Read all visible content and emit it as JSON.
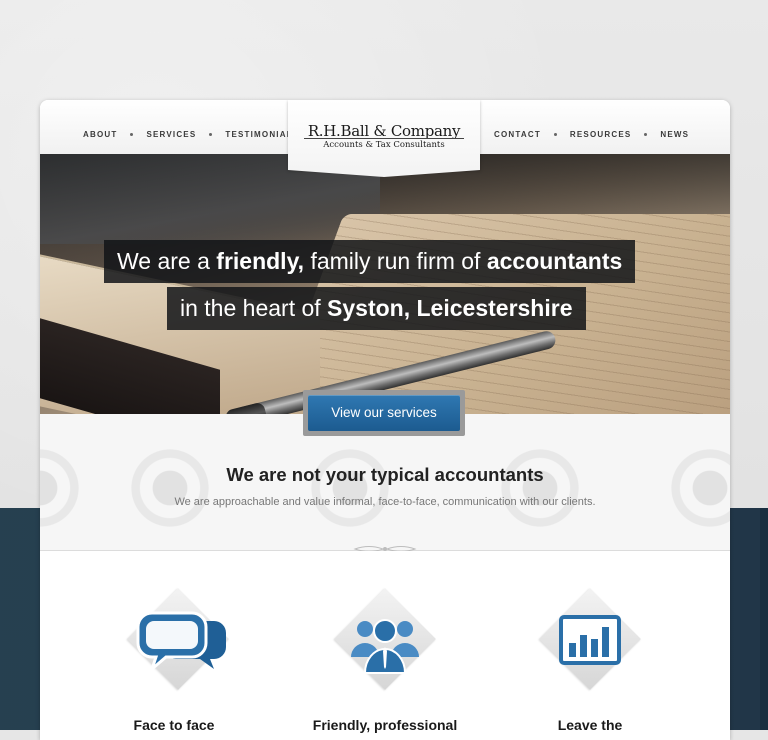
{
  "nav": {
    "left": [
      "About",
      "Services",
      "Testimonials"
    ],
    "right": [
      "Contact",
      "Resources",
      "News"
    ]
  },
  "logo": {
    "title": "R.H.Ball & Company",
    "subtitle": "Accounts & Tax Consultants"
  },
  "hero": {
    "line1": {
      "a": "We are a ",
      "b": "friendly,",
      "c": " family run firm of ",
      "d": "accountants"
    },
    "line2": {
      "a": "in the heart of ",
      "b": "Syston, Leicestershire"
    },
    "cta": "View our services"
  },
  "intro": {
    "title": "We are not your typical accountants",
    "text": "We are approachable and value informal, face-to-face, communication with our clients."
  },
  "features": [
    {
      "title": "Face to face",
      "icon": "speech-bubbles-icon"
    },
    {
      "title": "Friendly, professional",
      "icon": "team-icon"
    },
    {
      "title": "Leave the",
      "icon": "bar-chart-icon"
    }
  ],
  "colors": {
    "accent": "#2f78b2",
    "icon_blue": "#2a6fa8",
    "dark_band": "#1c3445"
  }
}
